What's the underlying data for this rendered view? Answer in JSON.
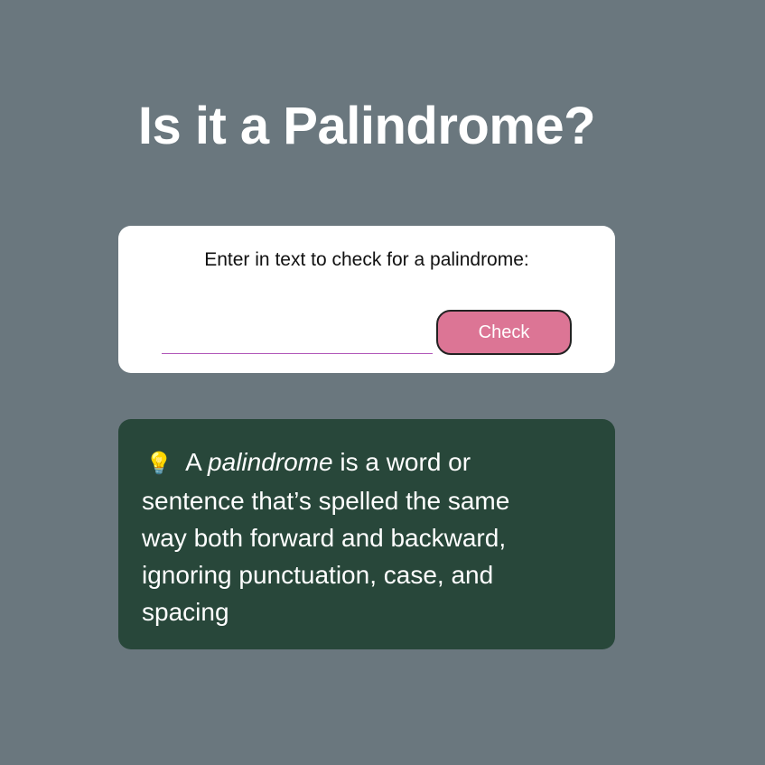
{
  "header": {
    "title": "Is it a Palindrome?"
  },
  "checker": {
    "label": "Enter in text to check for a palindrome:",
    "input_value": "",
    "button_label": "Check"
  },
  "info": {
    "icon": "lightbulb-icon",
    "icon_glyph": "💡",
    "prefix": "A",
    "term": "palindrome",
    "definition": "is a word or sentence that’s spelled the same way both forward and backward, ignoring punctuation, case, and spacing"
  },
  "colors": {
    "background": "#6a777e",
    "button": "#dc7595",
    "info_card": "#28473a",
    "input_underline": "#b055b8"
  }
}
